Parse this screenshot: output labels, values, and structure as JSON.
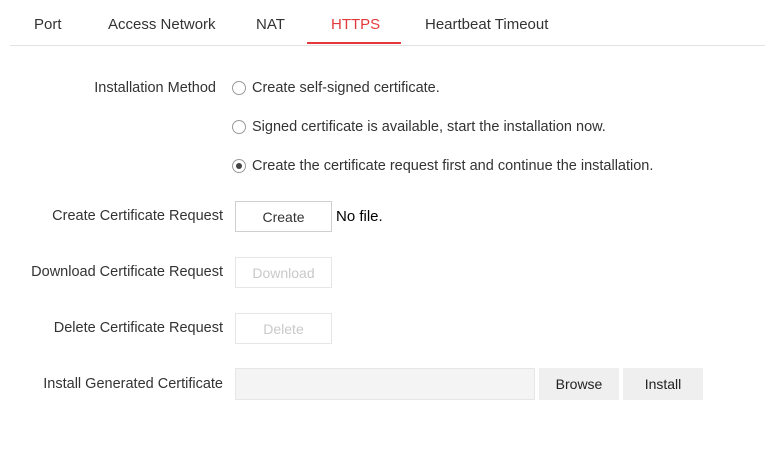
{
  "tabs": [
    {
      "label": "Port"
    },
    {
      "label": "Access Network"
    },
    {
      "label": "NAT"
    },
    {
      "label": "HTTPS",
      "active": true
    },
    {
      "label": "Heartbeat Timeout"
    }
  ],
  "accent_color": "#e4393c",
  "installation": {
    "label": "Installation Method",
    "options": [
      {
        "label": "Create self-signed certificate.",
        "selected": false
      },
      {
        "label": "Signed certificate is available, start the installation now.",
        "selected": false
      },
      {
        "label": "Create the certificate request first and continue the installation.",
        "selected": true
      }
    ]
  },
  "create_request": {
    "label": "Create Certificate Request",
    "button": "Create",
    "status": "No file."
  },
  "download_request": {
    "label": "Download Certificate Request",
    "button": "Download"
  },
  "delete_request": {
    "label": "Delete Certificate Request",
    "button": "Delete"
  },
  "install_generated": {
    "label": "Install Generated Certificate",
    "file_value": "",
    "browse_button": "Browse",
    "install_button": "Install"
  }
}
